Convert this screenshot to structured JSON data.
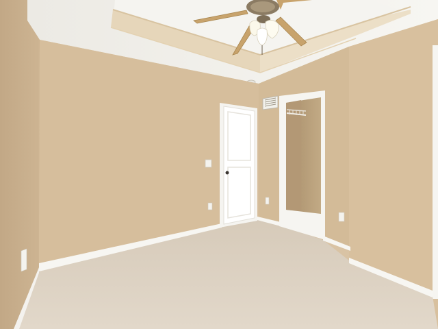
{
  "scene": {
    "kind": "photo",
    "room": "empty-bedroom",
    "features": [
      "tray-ceiling",
      "ceiling-fan-with-light",
      "closed-panel-door",
      "open-walk-in-closet",
      "air-vent",
      "light-switch",
      "wall-outlets",
      "baseboards",
      "carpet-floor"
    ]
  },
  "colors": {
    "wall_main": "#d7bf9e",
    "wall_left": "#c9b08e",
    "wall_right": "#d4bc9a",
    "ceiling": "#f3f1ec",
    "tray_band": "#e8d9bf",
    "carpet": "#dcd1c3",
    "trim_white": "#f7f6f2",
    "closet_interior": "#b9a07c",
    "fan_blade": "#c9a46e",
    "fan_metal": "#8a7a62"
  }
}
